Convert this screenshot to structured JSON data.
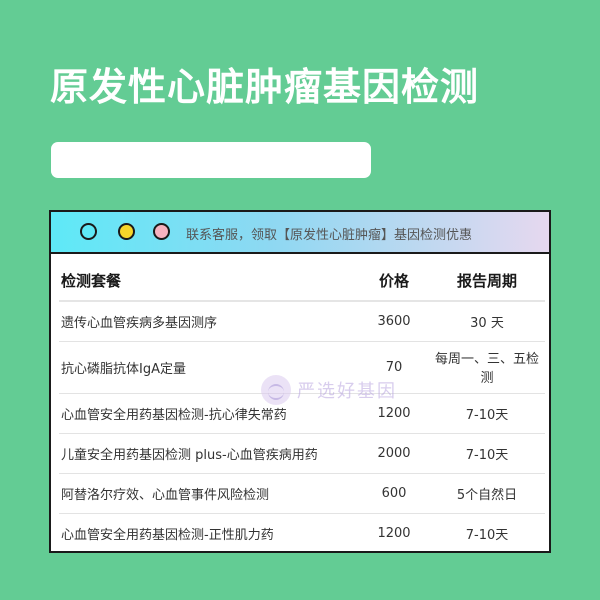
{
  "title": "原发性心脏肿瘤基因检测",
  "window": {
    "bar_text": "联系客服，领取【原发性心脏肿瘤】基因检测优惠",
    "watermark": "严选好基因"
  },
  "table": {
    "headers": [
      "检测套餐",
      "价格",
      "报告周期"
    ],
    "rows": [
      {
        "name": "遗传心血管疾病多基因测序",
        "price": "3600",
        "period": "30 天"
      },
      {
        "name": "抗心磷脂抗体IgA定量",
        "price": "70",
        "period": "每周一、三、五检测"
      },
      {
        "name": "心血管安全用药基因检测-抗心律失常药",
        "price": "1200",
        "period": "7-10天"
      },
      {
        "name": "儿童安全用药基因检测 plus-心血管疾病用药",
        "price": "2000",
        "period": "7-10天"
      },
      {
        "name": "阿替洛尔疗效、心血管事件风险检测",
        "price": "600",
        "period": "5个自然日"
      },
      {
        "name": "心血管安全用药基因检测-正性肌力药",
        "price": "1200",
        "period": "7-10天"
      }
    ]
  }
}
